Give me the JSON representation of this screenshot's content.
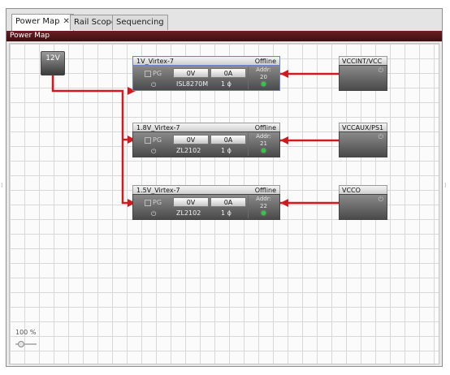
{
  "tabs": [
    {
      "label": "Power Map",
      "close": "✕"
    },
    {
      "label": "Rail Scope"
    },
    {
      "label": "Sequencing"
    }
  ],
  "panel_title": "Power Map",
  "source": {
    "label": "12V"
  },
  "rails": [
    {
      "name": "1V_Virtex-7",
      "status": "Offline",
      "pg": "PG",
      "voltage": "0V",
      "current": "0A",
      "device": "ISL8270M",
      "phase": "1 ϕ",
      "addr_label": "Addr:",
      "addr": "20"
    },
    {
      "name": "1.8V_Virtex-7",
      "status": "Offline",
      "pg": "PG",
      "voltage": "0V",
      "current": "0A",
      "device": "ZL2102",
      "phase": "1 ϕ",
      "addr_label": "Addr:",
      "addr": "21"
    },
    {
      "name": "1.5V_Virtex-7",
      "status": "Offline",
      "pg": "PG",
      "voltage": "0V",
      "current": "0A",
      "device": "ZL2102",
      "phase": "1 ϕ",
      "addr_label": "Addr:",
      "addr": "22"
    }
  ],
  "loads": [
    {
      "name": "VCCINT/VCC"
    },
    {
      "name": "VCCAUX/PS1"
    },
    {
      "name": "VCCO"
    }
  ],
  "zoom": {
    "label": "100 %",
    "level_percent": 100
  },
  "colors": {
    "wire": "#d11a1f",
    "title_bar": "#5a1a1d",
    "led": "#2ecc40"
  },
  "icons": {
    "power": "power-icon",
    "close": "close-icon",
    "slider": "zoom-slider-thumb"
  }
}
